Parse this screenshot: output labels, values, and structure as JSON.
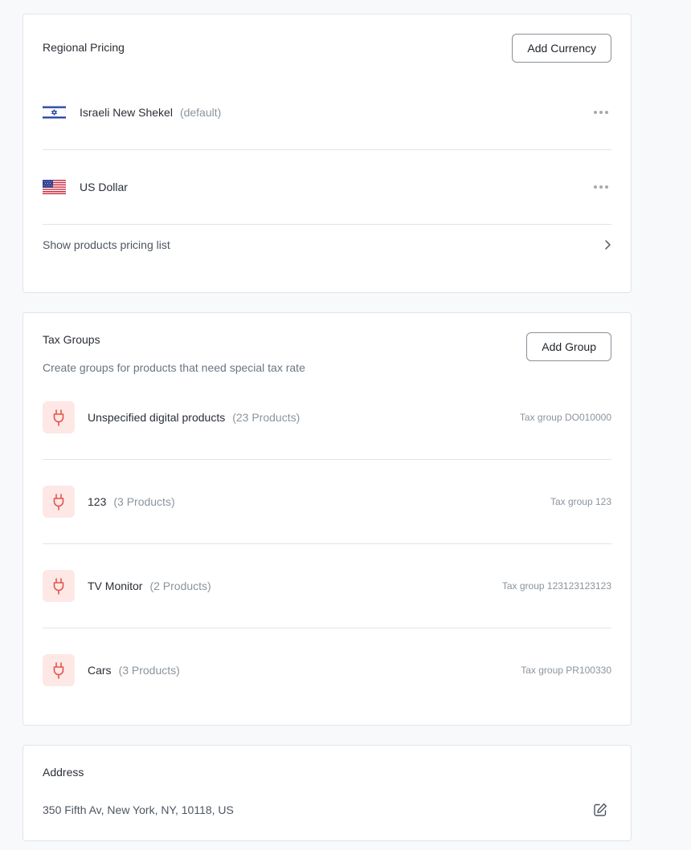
{
  "regional_pricing": {
    "title": "Regional Pricing",
    "add_button": "Add Currency",
    "currencies": [
      {
        "name": "Israeli New Shekel",
        "tag": "(default)",
        "flag": "israel-flag-icon"
      },
      {
        "name": "US Dollar",
        "tag": "",
        "flag": "usa-flag-icon"
      }
    ],
    "show_list_label": "Show products pricing list"
  },
  "tax_groups": {
    "title": "Tax Groups",
    "subtitle": "Create groups for products that need special tax rate",
    "add_button": "Add Group",
    "icon": "plug-icon",
    "accent_color": "#e5534b",
    "groups": [
      {
        "name": "Unspecified digital products",
        "count": "(23 Products)",
        "code": "Tax group DO010000"
      },
      {
        "name": "123",
        "count": "(3 Products)",
        "code": "Tax group 123"
      },
      {
        "name": "TV Monitor",
        "count": "(2 Products)",
        "code": "Tax group 123123123123"
      },
      {
        "name": "Cars",
        "count": "(3 Products)",
        "code": "Tax group PR100330"
      }
    ]
  },
  "address": {
    "title": "Address",
    "value": "350 Fifth Av, New York, NY, 10118, US",
    "edit_icon": "edit-icon"
  }
}
